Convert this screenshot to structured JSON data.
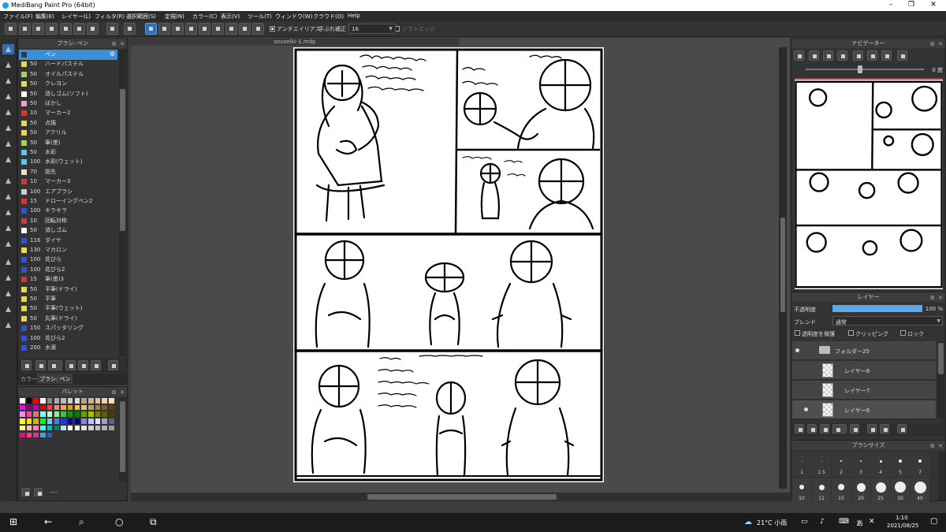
{
  "window": {
    "title": "MediBang Paint Pro (64bit)"
  },
  "menu": [
    "ファイル(F)",
    "編集(E)",
    "レイヤー(L)",
    "フィルタ(R)",
    "選択範囲(S)",
    "定規(N)",
    "カラー(C)",
    "表示(V)",
    "ツール(T)",
    "ウィンドウ(W)",
    "クラウド(O)",
    "Help"
  ],
  "toolbar": {
    "antialias_label": "アンチエイリアス",
    "hand_label": "手ぶれ補正",
    "hand_value": "16",
    "softedge_label": "ソフトエッジ"
  },
  "brush_panel": {
    "title": "ブラシ: ペン",
    "items": [
      {
        "size": "",
        "name": "ペン",
        "color": "#3a3a3a"
      },
      {
        "size": "50",
        "name": "ハードパステル",
        "color": "#e8d84a"
      },
      {
        "size": "50",
        "name": "オイルパステル",
        "color": "#a8d060"
      },
      {
        "size": "50",
        "name": "クレヨン",
        "color": "#e0e040"
      },
      {
        "size": "50",
        "name": "消しゴム(ソフト)",
        "color": "#ffffff"
      },
      {
        "size": "50",
        "name": "ぼかし",
        "color": "#f0a0d0"
      },
      {
        "size": "10",
        "name": "マーカー2",
        "color": "#e03030"
      },
      {
        "size": "50",
        "name": "点描",
        "color": "#e8d84a"
      },
      {
        "size": "50",
        "name": "アクリル",
        "color": "#e8d84a"
      },
      {
        "size": "50",
        "name": "筆(墨)",
        "color": "#a8d060"
      },
      {
        "size": "50",
        "name": "水彩",
        "color": "#60c0f0"
      },
      {
        "size": "100",
        "name": "水彩(ウェット)",
        "color": "#60c0f0"
      },
      {
        "size": "70",
        "name": "指先",
        "color": "#f0e0c0"
      },
      {
        "size": "10",
        "name": "マーカー3",
        "color": "#e03030"
      },
      {
        "size": "100",
        "name": "エアブラシ",
        "color": "#cccccc"
      },
      {
        "size": "15",
        "name": "ドローイングペン2",
        "color": "#e03030"
      },
      {
        "size": "100",
        "name": "キラキラ",
        "color": "#3050e0"
      },
      {
        "size": "10",
        "name": "回転対称",
        "color": "#e03030"
      },
      {
        "size": "50",
        "name": "消しゴム",
        "color": "#ffffff"
      },
      {
        "size": "116",
        "name": "ダイヤ",
        "color": "#3050e0"
      },
      {
        "size": "130",
        "name": "マカロン",
        "color": "#e8d84a"
      },
      {
        "size": "100",
        "name": "花びら",
        "color": "#3050e0"
      },
      {
        "size": "100",
        "name": "花びら2",
        "color": "#3050e0"
      },
      {
        "size": "15",
        "name": "筆(墨)3",
        "color": "#e03030"
      },
      {
        "size": "50",
        "name": "平筆(ドライ)",
        "color": "#e8d84a"
      },
      {
        "size": "50",
        "name": "平筆",
        "color": "#e8d84a"
      },
      {
        "size": "50",
        "name": "平筆(ウェット)",
        "color": "#e8d84a"
      },
      {
        "size": "50",
        "name": "丸筆(ドライ)",
        "color": "#e8d84a"
      },
      {
        "size": "150",
        "name": "スパッタリング",
        "color": "#3050e0"
      },
      {
        "size": "100",
        "name": "花びら2",
        "color": "#3050e0"
      },
      {
        "size": "200",
        "name": "水滴",
        "color": "#3050e0"
      }
    ],
    "tabs": [
      "カラー",
      "ブラシ: ペン"
    ]
  },
  "palette_panel": {
    "title": "パレット",
    "footer": "----"
  },
  "document": {
    "tab": "souseiki-1.mdp"
  },
  "navigator": {
    "title": "ナビゲーター",
    "angle": "0 度"
  },
  "layer_panel": {
    "title": "レイヤー",
    "opacity_label": "不透明度",
    "opacity_value": "100 %",
    "opacity_fraction": 1.0,
    "blend_label": "ブレンド",
    "blend_value": "通常",
    "protect_label": "透明度を保護",
    "clip_label": "クリッピング",
    "lock_label": "ロック",
    "layers": [
      {
        "name": "フォルダー25",
        "type": "folder",
        "visible": true
      },
      {
        "name": "レイヤー8",
        "type": "layer",
        "visible": false
      },
      {
        "name": "レイヤー7",
        "type": "layer",
        "visible": false
      },
      {
        "name": "レイヤー6",
        "type": "layer",
        "visible": true
      }
    ]
  },
  "brushsize_panel": {
    "title": "ブラシサイズ",
    "sizes": [
      "1",
      "1.5",
      "2",
      "3",
      "4",
      "5",
      "7",
      "10",
      "12",
      "15",
      "20",
      "25",
      "30",
      "40"
    ]
  },
  "taskbar": {
    "weather": "21°C 小雨",
    "time": "1:10",
    "date": "2021/08/25",
    "ime": "あ"
  }
}
